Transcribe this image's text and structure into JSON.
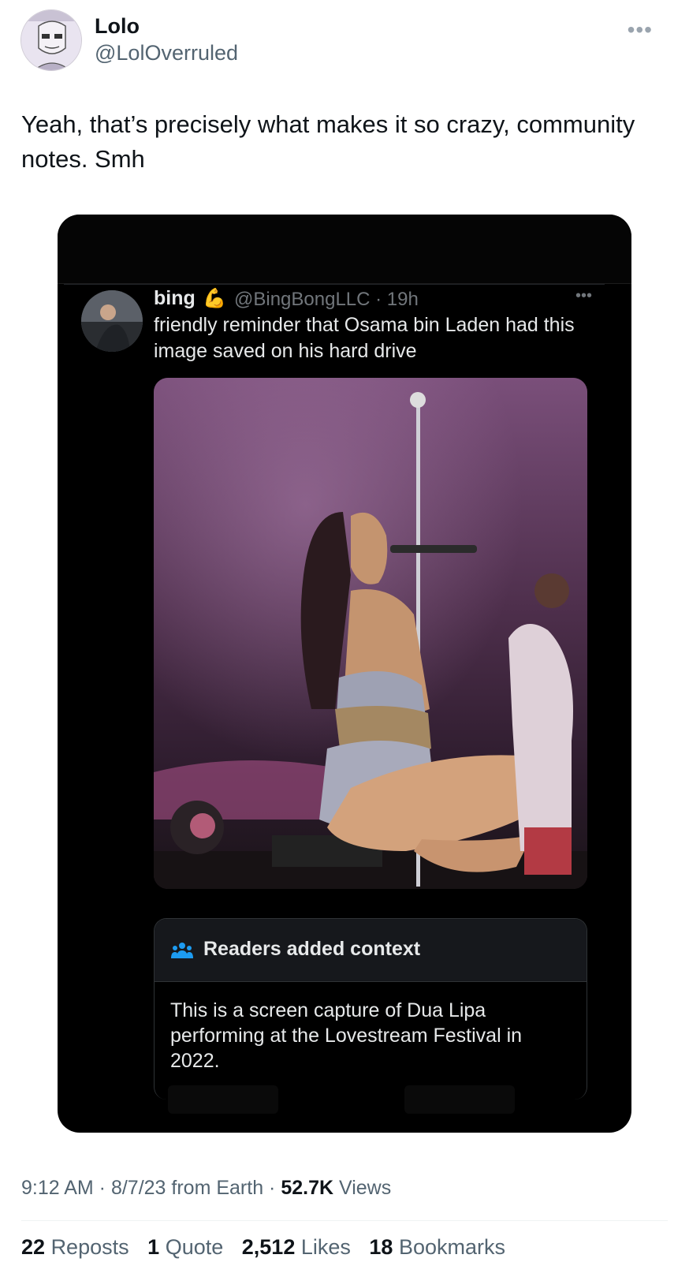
{
  "author": {
    "display_name": "Lolo",
    "handle": "@LolOverruled",
    "avatar_icon": "avatar-sketch-icon",
    "more_icon": "more-options-icon"
  },
  "tweet": {
    "text": "Yeah, that’s precisely what makes it so crazy, community notes. Smh"
  },
  "quoted_screenshot": {
    "author_name": "bing",
    "author_emoji": "💪",
    "handle_time": "@BingBongLLC · 19h",
    "text": "friendly reminder that Osama bin Laden had this image saved on his hard drive",
    "community_note": {
      "title": "Readers added context",
      "icon": "people-icon",
      "body": "This is a screen capture of Dua Lipa performing at the Lovestream Festival in 2022."
    }
  },
  "meta": {
    "time_date": "9:12 AM · 8/7/23 from Earth · ",
    "views_count": "52.7K",
    "views_label": " Views"
  },
  "stats": {
    "reposts_count": "22",
    "reposts_label": "Reposts",
    "quote_count": "1",
    "quote_label": "Quote",
    "likes_count": "2,512",
    "likes_label": "Likes",
    "bookmarks_count": "18",
    "bookmarks_label": "Bookmarks"
  },
  "colors": {
    "text_primary": "#0f1419",
    "text_secondary": "#536471",
    "note_icon": "#1d9bf0"
  }
}
